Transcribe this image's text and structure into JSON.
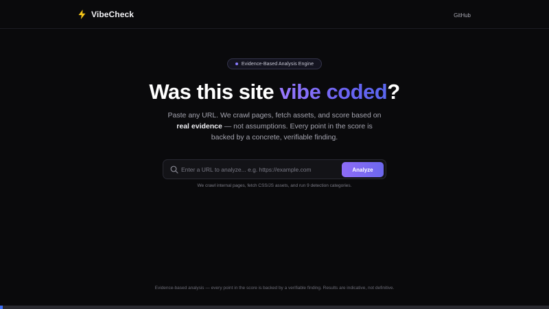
{
  "header": {
    "brand_icon": "lightning-bolt-icon",
    "brand_name": "VibeCheck",
    "github_link": "GitHub"
  },
  "hero": {
    "badge_text": "Evidence-Based Analysis Engine",
    "headline_prefix": "Was this site ",
    "headline_highlight": "vibe coded",
    "headline_suffix": "?",
    "subtitle_part1": "Paste any URL. We crawl pages, fetch assets, and score based on ",
    "subtitle_bold": "real evidence",
    "subtitle_part2": " — not assumptions. Every point in the score is backed by a concrete, verifiable finding."
  },
  "search": {
    "icon": "search-icon",
    "placeholder": "Enter a URL to analyze... e.g. https://example.com",
    "value": "",
    "button_label": "Analyze",
    "hint": "We crawl internal pages, fetch CSS/JS assets, and run 9 detection categories."
  },
  "footer": {
    "text": "Evidence-based analysis — every point in the score is backed by a verifiable finding. Results are indicative, not definitive."
  },
  "loading_bar": {
    "progress_percent": 0.5
  },
  "colors": {
    "background": "#0a0a0c",
    "accent_start": "#9a79ff",
    "accent_end": "#5a67f0",
    "button_start": "#8e6cf7",
    "button_end": "#6c67ee",
    "bolt": "#f5c518",
    "progress": "#3d6ff5"
  }
}
